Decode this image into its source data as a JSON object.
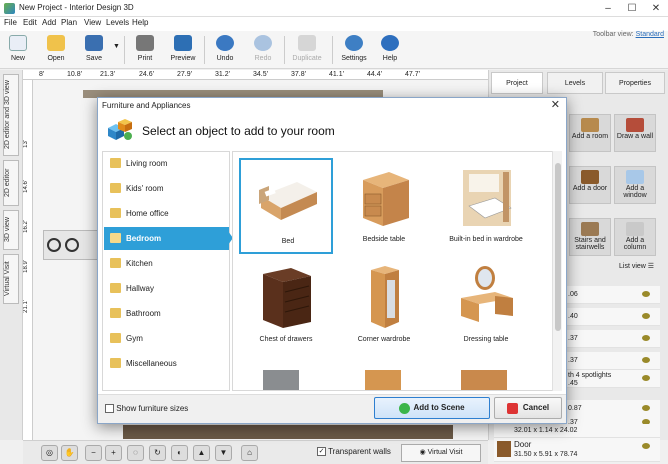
{
  "window": {
    "title": "New Project - Interior Design 3D",
    "controls": [
      "–",
      "☐",
      "✕"
    ]
  },
  "menu": [
    "File",
    "Edit",
    "Add",
    "Plan",
    "View",
    "Levels",
    "Help"
  ],
  "toolbar": {
    "buttons": [
      "New",
      "Open",
      "Save",
      "Print",
      "Preview",
      "Undo",
      "Redo",
      "Duplicate",
      "Settings",
      "Help"
    ],
    "view_label": "Toolbar view:",
    "view_value": "Standard"
  },
  "left_tabs": [
    "2D editor and 3D view",
    "2D editor",
    "3D view",
    "Virtual Visit"
  ],
  "ruler": [
    "8'",
    "10.8'",
    "21.3'",
    "24.6'",
    "27.9'",
    "31.2'",
    "34.5'",
    "37.8'",
    "41.1'",
    "44.4'",
    "47.7'"
  ],
  "ruler_v": [
    "13'",
    "14.6'",
    "16.2'",
    "18.9'",
    "21.1'"
  ],
  "right_panel": {
    "tabs": [
      "Project",
      "Levels",
      "Properties"
    ],
    "tiles": [
      {
        "label": "Add a room"
      },
      {
        "label": "Draw a wall"
      },
      {
        "label": "Add a door"
      },
      {
        "label": "Add a window"
      },
      {
        "label": "Stairs and stairwells"
      },
      {
        "label": "Add a column"
      }
    ],
    "list_view_label": "List view",
    "list_items": [
      {
        "text": ".06"
      },
      {
        "text": ".40"
      },
      {
        "text": ".37"
      },
      {
        "text": ".37"
      },
      {
        "text": "th 4 spotlights"
      },
      {
        "text": ".45"
      },
      {
        "text": "0.87"
      },
      {
        "text": ".37"
      },
      {
        "text": "32.01 x 1.14 x 24.02"
      },
      {
        "text": "Door"
      },
      {
        "text": "31.50 x 5.91 x 78.74"
      }
    ]
  },
  "bottom_bar": {
    "transparent_walls": "Transparent walls",
    "virtual_visit": "Virtual Visit"
  },
  "dialog": {
    "window_title": "Furniture and Appliances",
    "close": "✕",
    "heading": "Select an object to add to your room",
    "categories": [
      "Living room",
      "Kids' room",
      "Home office",
      "Bedroom",
      "Kitchen",
      "Hallway",
      "Bathroom",
      "Gym",
      "Miscellaneous"
    ],
    "selected_category": "Bedroom",
    "items": [
      {
        "name": "Bed",
        "selected": true
      },
      {
        "name": "Bedside table",
        "selected": false
      },
      {
        "name": "Built-in bed in wardrobe",
        "selected": false
      },
      {
        "name": "Chest of drawers",
        "selected": false
      },
      {
        "name": "Corner wardrobe",
        "selected": false
      },
      {
        "name": "Dressing table",
        "selected": false
      }
    ],
    "show_sizes_label": "Show furniture sizes",
    "add_button": "Add to Scene",
    "cancel_button": "Cancel"
  },
  "colors": {
    "accent": "#2e9fd8",
    "dialog_border": "#8aa6c8",
    "wood": "#c8874a"
  }
}
